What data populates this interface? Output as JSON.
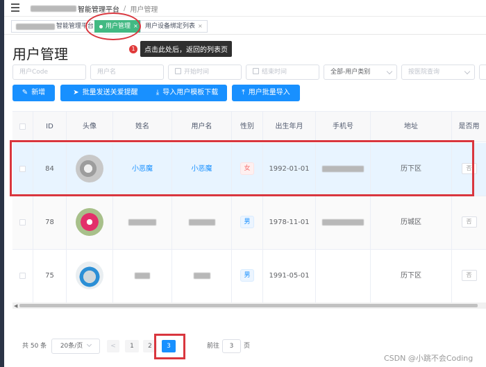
{
  "breadcrumb": {
    "platform": "智能管理平台",
    "separator": "/",
    "current": "用户管理"
  },
  "tabs": [
    {
      "label": "智能管理平台"
    },
    {
      "label": "用户管理",
      "close": "×"
    },
    {
      "label": "用户设备绑定列表",
      "close": "×"
    }
  ],
  "page_title": "用户管理",
  "annotation": {
    "number": "1",
    "text": "点击此处后，返回的列表页"
  },
  "filters": {
    "user_code": "用户Code",
    "user_name": "用户名",
    "start_time": "开始时间",
    "end_time": "结束时间",
    "user_type": "全部-用户类别",
    "hospital": "按医院查询"
  },
  "buttons": {
    "add": "新增",
    "bulk_remind": "批量发送关爱提醒",
    "download_template": "导入用户模板下载",
    "bulk_import": "用户批量导入"
  },
  "table": {
    "headers": [
      "ID",
      "头像",
      "姓名",
      "用户名",
      "性别",
      "出生年月",
      "手机号",
      "地址",
      "是否用"
    ],
    "rows": [
      {
        "id": "84",
        "name": "小恶魔",
        "username": "小恶魔",
        "gender": "女",
        "birth": "1992-01-01",
        "address": "历下区",
        "status": "否"
      },
      {
        "id": "78",
        "name": "",
        "username": "",
        "gender": "男",
        "birth": "1978-11-01",
        "address": "历城区",
        "status": "否"
      },
      {
        "id": "75",
        "name": "",
        "username": "",
        "gender": "男",
        "birth": "1991-05-01",
        "address": "历下区",
        "status": "否"
      }
    ]
  },
  "pagination": {
    "total": "共 50 条",
    "page_size": "20条/页",
    "prev": "<",
    "pages": [
      "1",
      "2",
      "3"
    ],
    "current_page": 3,
    "goto_label": "前往",
    "goto_value": "3",
    "goto_unit": "页"
  },
  "watermark": "CSDN @小跳不会Coding",
  "colors": {
    "primary": "#1890ff",
    "active_tag": "#42b983",
    "highlight_border": "#d9363e"
  }
}
